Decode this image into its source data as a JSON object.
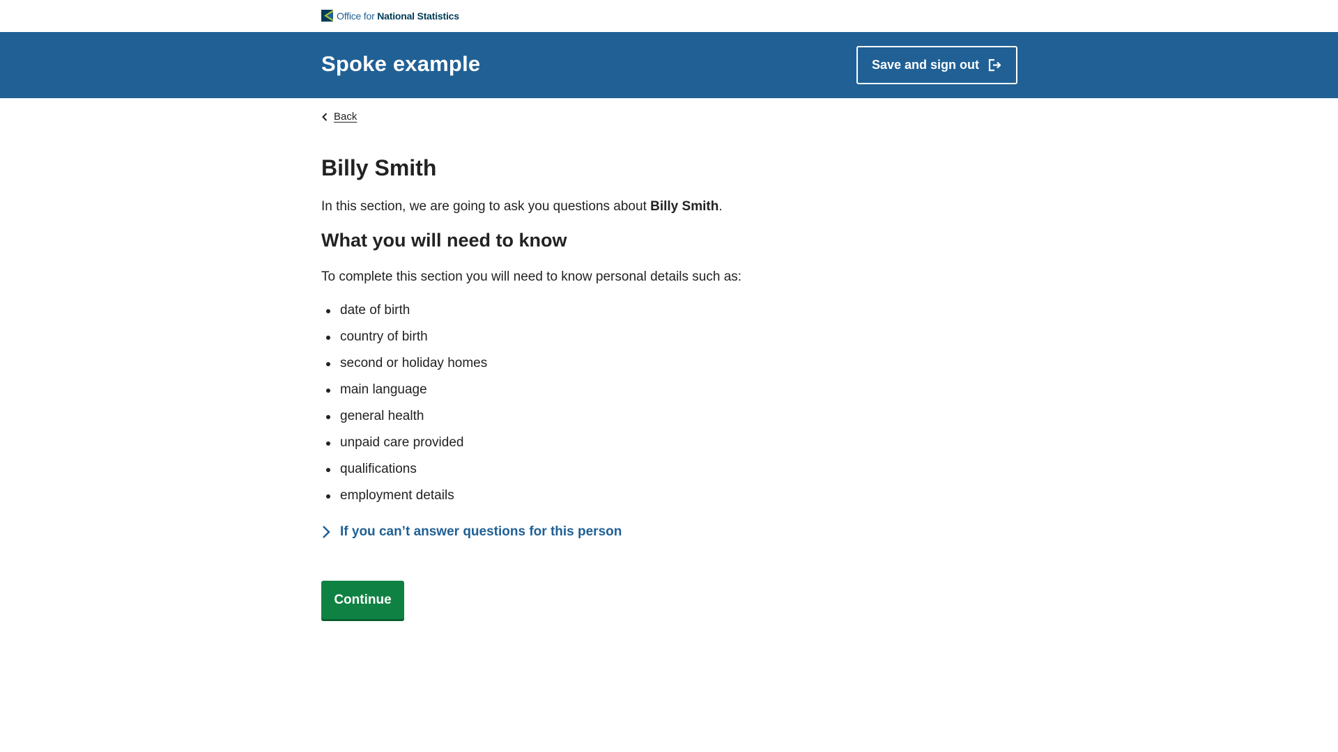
{
  "brand": {
    "prefix": "Office for ",
    "name": "National Statistics"
  },
  "header": {
    "service_title": "Spoke example",
    "signout_label": "Save and sign out"
  },
  "nav": {
    "back_label": "Back"
  },
  "page": {
    "title": "Billy Smith",
    "intro_prefix": "In this section, we are going to ask you questions about ",
    "intro_name": "Billy Smith",
    "intro_suffix": ".",
    "section_heading": "What you will need to know",
    "lead": "To complete this section you will need to know personal details such as:",
    "items": [
      "date of birth",
      "country of birth",
      "second or holiday homes",
      "main language",
      "general health",
      "unpaid care provided",
      "qualifications",
      "employment details"
    ],
    "disclosure_label": "If you can’t answer questions for this person",
    "continue_label": "Continue"
  },
  "colors": {
    "brand_blue": "#206095",
    "button_green": "#0f8243",
    "text": "#222222"
  },
  "icons": [
    "ons-logo-icon",
    "sign-out-icon",
    "chevron-left-icon",
    "chevron-right-icon"
  ]
}
